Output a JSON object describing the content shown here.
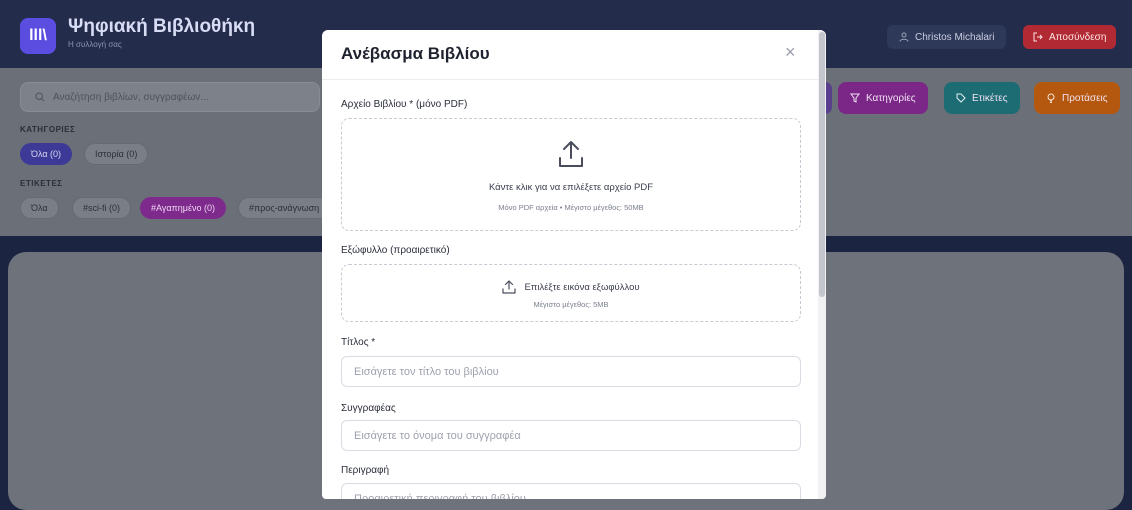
{
  "app": {
    "title": "Ψηφιακή Βιβλιοθήκη",
    "subtitle": "Η συλλογή σας",
    "logo_glyph": "lll\\",
    "user_name": "Christos Michalari",
    "logout_label": "Αποσύνδεση"
  },
  "filters": {
    "search_placeholder": "Αναζήτηση βιβλίων, συγγραφέων...",
    "categories_heading": "ΚΑΤΗΓΟΡΙΕΣ",
    "categories": [
      {
        "label": "Όλα (0)",
        "active": true
      },
      {
        "label": "Ιστορία (0)",
        "active": false
      }
    ],
    "tags_heading": "ΕΤΙΚΕΤΕΣ",
    "tags": [
      {
        "label": "Όλα",
        "active": false
      },
      {
        "label": "#sci-fi (0)",
        "active": false
      },
      {
        "label": "#Αγαπημένο (0)",
        "active": true
      },
      {
        "label": "#προς-ανάγνωση",
        "active": false
      }
    ]
  },
  "toolbar": {
    "categories_label": "Κατηγορίες",
    "tags_label": "Ετικέτες",
    "suggestions_label": "Προτάσεις"
  },
  "modal": {
    "title": "Ανέβασμα Βιβλίου",
    "close_glyph": "×",
    "file_label": "Αρχείο Βιβλίου * (μόνο PDF)",
    "file_prompt": "Κάντε κλικ για να επιλέξετε αρχείο PDF",
    "file_hint": "Μόνο PDF αρχεία • Μέγιστο μέγεθος: 50MB",
    "cover_label": "Εξώφυλλο (προαιρετικό)",
    "cover_prompt": "Επιλέξτε εικόνα εξωφύλλου",
    "cover_hint": "Μέγιστο μέγεθος: 5MB",
    "title_label": "Τίτλος *",
    "title_placeholder": "Εισάγετε τον τίτλο του βιβλίου",
    "author_label": "Συγγραφέας",
    "author_placeholder": "Εισάγετε το όνομα του συγγραφέα",
    "description_label": "Περιγραφή",
    "description_placeholder": "Προαιρετική περιγραφή του βιβλίου"
  },
  "colors": {
    "accent_purple": "#5b4de0",
    "logout_red": "#b12a33",
    "categories_btn": "#7a2787",
    "tags_btn": "#1d6b73",
    "suggestions_btn": "#b5580f"
  },
  "icons": {
    "logo": "library-icon",
    "user": "user-icon",
    "logout": "logout-icon",
    "search": "search-icon",
    "filter": "filter-icon",
    "tag": "tag-icon",
    "suggestion": "lightbulb-icon",
    "upload": "upload-icon",
    "close": "close-icon"
  }
}
